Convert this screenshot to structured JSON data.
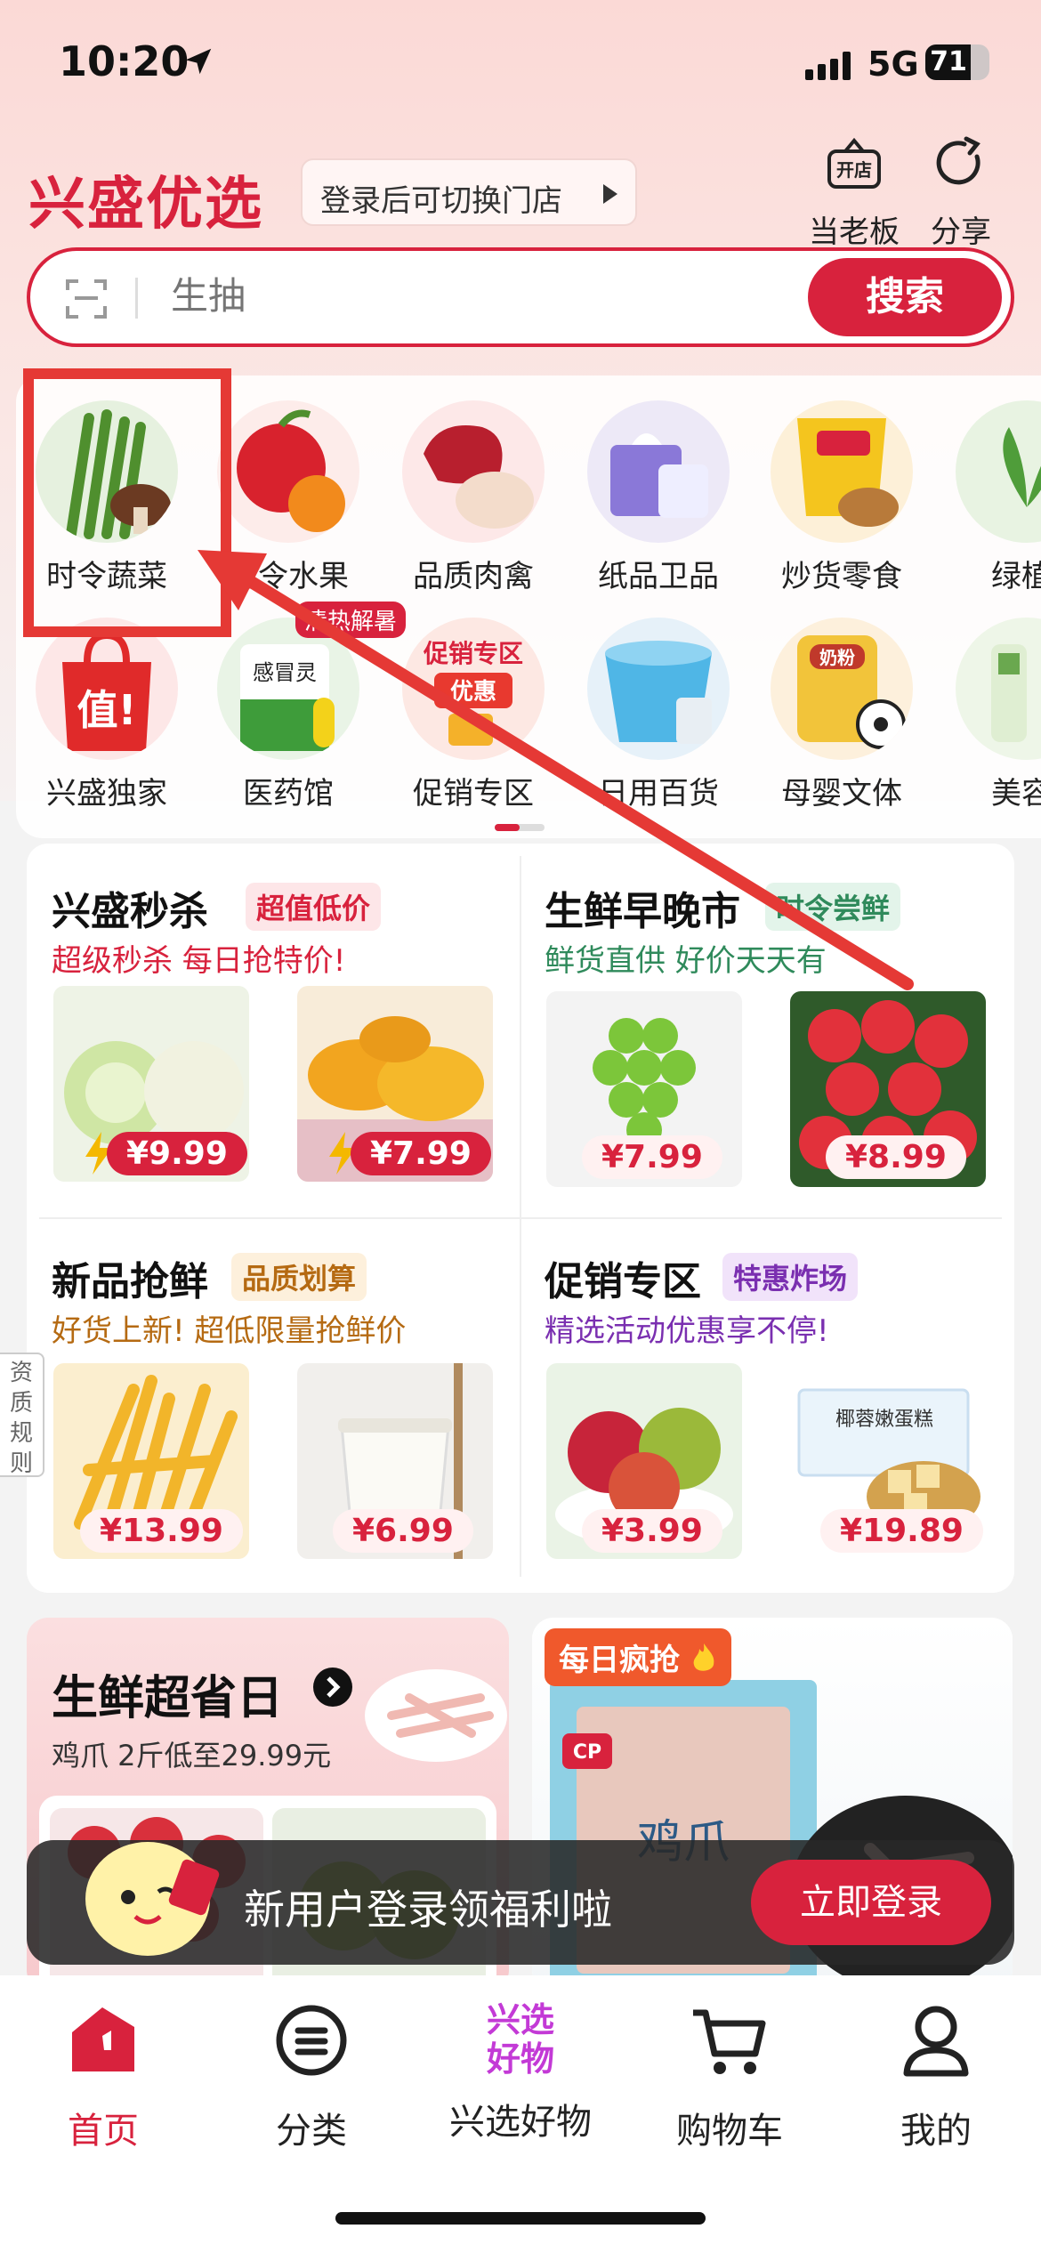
{
  "status": {
    "time": "10:20",
    "network": "5G",
    "battery": "71",
    "battery_level": 0.71
  },
  "header": {
    "brand": "兴盛优选",
    "store_text": "登录后可切换门店",
    "boss_badge": "开店",
    "boss_label": "当老板",
    "share_label": "分享"
  },
  "search": {
    "placeholder": "生抽",
    "button": "搜索"
  },
  "categories": [
    {
      "label": "时令蔬菜",
      "icon": "asparagus-icon"
    },
    {
      "label": "时令水果",
      "icon": "apple-orange-icon"
    },
    {
      "label": "品质肉禽",
      "icon": "meat-icon"
    },
    {
      "label": "纸品卫品",
      "icon": "tissue-icon"
    },
    {
      "label": "炒货零食",
      "icon": "snack-icon"
    },
    {
      "label": "绿植",
      "icon": "plant-icon"
    },
    {
      "label": "兴盛独家",
      "icon": "shopping-bag-icon",
      "inner": "值!"
    },
    {
      "label": "医药馆",
      "icon": "medicine-icon",
      "badge": "清热解暑",
      "inner": "感冒灵"
    },
    {
      "label": "促销专区",
      "icon": "promo-icon",
      "inner": "促销专区",
      "inner2": "优惠"
    },
    {
      "label": "日用百货",
      "icon": "bucket-icon"
    },
    {
      "label": "母婴文体",
      "icon": "milk-powder-icon",
      "inner": "奶粉"
    },
    {
      "label": "美容",
      "icon": "beauty-icon"
    }
  ],
  "sections": {
    "flash": {
      "title": "兴盛秒杀",
      "tag": "超值低价",
      "subtitle": "超级秒杀 每日抢特价!",
      "prices": [
        "¥9.99",
        "¥7.99"
      ]
    },
    "fresh": {
      "title": "生鲜早晚市",
      "tag": "时令尝鲜",
      "subtitle": "鲜货直供 好价天天有",
      "prices": [
        "¥7.99",
        "¥8.99"
      ]
    },
    "new": {
      "title": "新品抢鲜",
      "tag": "品质划算",
      "subtitle": "好货上新! 超低限量抢鲜价",
      "prices": [
        "¥13.99",
        "¥6.99"
      ]
    },
    "promo": {
      "title": "促销专区",
      "tag": "特惠炸场",
      "subtitle": "精选活动优惠享不停!",
      "prices": [
        "¥3.99",
        "¥19.89"
      ],
      "box_text": "椰蓉嫩蛋糕"
    }
  },
  "side_tab": {
    "label": "资质规则"
  },
  "promo_day": {
    "title": "生鲜超省日",
    "subtitle": "鸡爪 2斤低至29.99元"
  },
  "daily_grab": {
    "tag": "每日疯抢",
    "bag_label": "鸡爪",
    "bag_brand": "CP"
  },
  "toast": {
    "text": "新用户登录领福利啦",
    "button": "立即登录"
  },
  "tabbar": [
    {
      "label": "首页",
      "icon": "home-icon",
      "active": true
    },
    {
      "label": "分类",
      "icon": "category-icon"
    },
    {
      "label": "兴选好物",
      "icon": "xingxuan-logo-icon",
      "logo_top": "兴选",
      "logo_bottom": "好物"
    },
    {
      "label": "购物车",
      "icon": "cart-icon"
    },
    {
      "label": "我的",
      "icon": "profile-icon"
    }
  ],
  "colors": {
    "brand_red": "#d8223d",
    "fresh_green": "#2f8a5b",
    "promo_purple": "#7a2fb0"
  }
}
